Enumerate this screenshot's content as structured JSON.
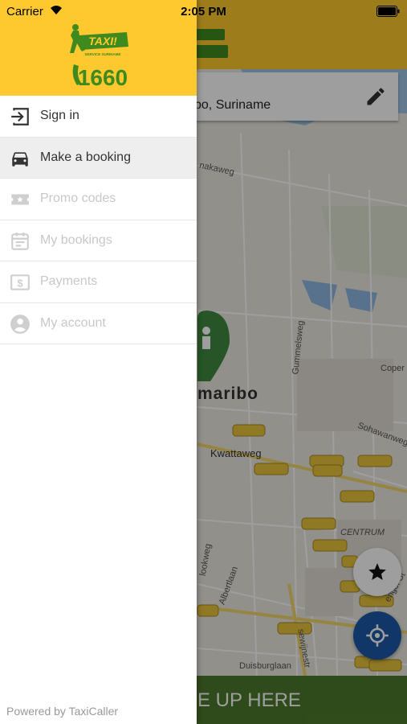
{
  "status_bar": {
    "carrier": "Carrier",
    "time": "2:05 PM"
  },
  "brand": {
    "logo_text": "TAXI!",
    "logo_subtext": "SERVICE SURINAME",
    "phone": "1660",
    "logo_colors": {
      "green": "#3f8a1f",
      "yellow": "#fdc92e"
    }
  },
  "drawer": {
    "items": [
      {
        "label": "Sign in",
        "icon": "sign-in-icon",
        "state": "enabled"
      },
      {
        "label": "Make a booking",
        "icon": "car-icon",
        "state": "active"
      },
      {
        "label": "Promo codes",
        "icon": "ticket-icon",
        "state": "disabled"
      },
      {
        "label": "My bookings",
        "icon": "calendar-icon",
        "state": "disabled"
      },
      {
        "label": "Payments",
        "icon": "dollar-icon",
        "state": "disabled"
      },
      {
        "label": "My account",
        "icon": "account-icon",
        "state": "disabled"
      }
    ],
    "footer": "Powered by TaxiCaller"
  },
  "address": {
    "value": "bo, Suriname"
  },
  "map": {
    "street_labels": [
      "nakaweg",
      "Gummelsweg",
      "Coper",
      "Sohawanweg",
      "Kwattaweg",
      "CENTRUM",
      "Albertlaan",
      "lookweg",
      "Duisburglaan",
      "sewijnestr",
      "engel St"
    ],
    "city_label": "maribo"
  },
  "pickup": {
    "label": "E UP HERE"
  },
  "colors": {
    "header_yellow": "#fdc92e",
    "pickup_green": "#4e7a2c",
    "locate_blue": "#1a5aa8",
    "active_row": "#eeeeee",
    "disabled_text": "#c8c8c8"
  }
}
